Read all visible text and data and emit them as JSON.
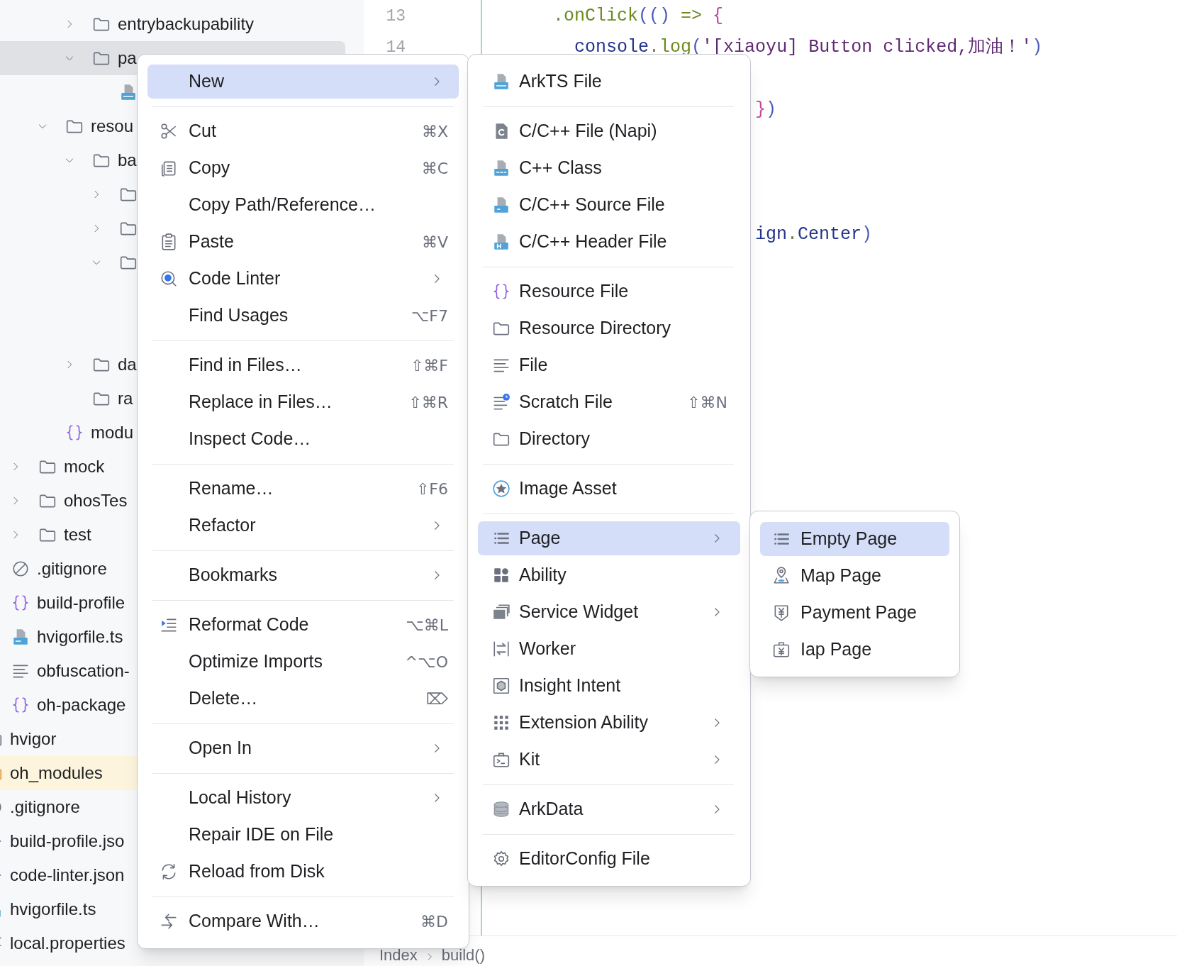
{
  "project_tree": {
    "items": [
      {
        "kind": "offscreen",
        "children": [
          {
            "kind": "offscreen",
            "children": [
              {
                "kind": "offscreen",
                "children": [
                  {
                    "kind": "offscreen",
                    "children": [
                      {
                        "kind": "folder",
                        "label": "entrybackupability",
                        "expanded": false,
                        "selected": false
                      },
                      {
                        "kind": "folder",
                        "label": "pa",
                        "expanded": true,
                        "selected": true,
                        "children": [
                          {
                            "kind": "ets-file",
                            "selected": false
                          }
                        ]
                      }
                    ]
                  },
                  {
                    "kind": "folder",
                    "label": "resou",
                    "expanded": true,
                    "selected": false,
                    "children": [
                      {
                        "kind": "folder",
                        "label": "ba",
                        "expanded": true,
                        "selected": false,
                        "children": [
                          {
                            "kind": "folder",
                            "expanded": false,
                            "selected": false
                          },
                          {
                            "kind": "folder",
                            "expanded": false,
                            "selected": false
                          },
                          {
                            "kind": "folder",
                            "expanded": true,
                            "selected": false,
                            "children": [
                              {
                                "kind": "covered"
                              },
                              {
                                "kind": "covered"
                              }
                            ]
                          }
                        ]
                      },
                      {
                        "kind": "folder",
                        "label": "da",
                        "expanded": false,
                        "selected": false
                      },
                      {
                        "kind": "folder",
                        "label": "ra",
                        "selected": false
                      }
                    ]
                  },
                  {
                    "kind": "json-file",
                    "label": "modu",
                    "selected": false
                  }
                ]
              },
              {
                "kind": "folder",
                "label": "mock",
                "expanded": false,
                "selected": false
              },
              {
                "kind": "folder",
                "label": "ohosTes",
                "expanded": false,
                "selected": false
              },
              {
                "kind": "folder",
                "label": "test",
                "expanded": false,
                "selected": false
              }
            ]
          },
          {
            "kind": "ignore-file",
            "label": ".gitignore",
            "selected": false
          },
          {
            "kind": "json-file",
            "label": "build-profile",
            "selected": false
          },
          {
            "kind": "ts-file",
            "label": "hvigorfile.ts",
            "selected": false
          },
          {
            "kind": "text-file",
            "label": "obfuscation-",
            "selected": false
          },
          {
            "kind": "json-file",
            "label": "oh-package",
            "selected": false
          }
        ]
      },
      {
        "kind": "folder",
        "label": "hvigor",
        "selected": false
      },
      {
        "kind": "library-folder",
        "label": "oh_modules",
        "selected": false
      },
      {
        "kind": "ignore-file",
        "label": ".gitignore",
        "selected": false
      },
      {
        "kind": "json-file",
        "label": "build-profile.jso",
        "selected": false
      },
      {
        "kind": "json-file",
        "label": "code-linter.json",
        "selected": false
      },
      {
        "kind": "ts-file",
        "label": "hvigorfile.ts",
        "selected": false
      },
      {
        "kind": "text-file",
        "label": "local.properties",
        "selected": false
      }
    ]
  },
  "editor": {
    "lines": [
      {
        "kind": "code",
        "number": "13",
        "tokens": [
          {
            "text": "      .",
            "kind": "dot"
          },
          {
            "text": "onClick",
            "kind": "method"
          },
          {
            "text": "(() ",
            "kind": "paren"
          },
          {
            "text": "=>",
            "kind": "operator"
          },
          {
            "text": " {",
            "kind": "brace"
          }
        ]
      },
      {
        "kind": "code",
        "number": "14",
        "tokens": [
          {
            "text": "        console",
            "kind": "ident"
          },
          {
            "text": ".",
            "kind": "dot"
          },
          {
            "text": "log",
            "kind": "method"
          },
          {
            "text": "(",
            "kind": "paren"
          },
          {
            "text": "'[xiaoyu] Button clicked,加油！'",
            "kind": "string"
          },
          {
            "text": ")",
            "kind": "paren"
          }
        ]
      },
      {
        "kind": "covered"
      },
      {
        "kind": "code",
        "tokens": [
          {
            "text": "                         }",
            "kind": "brace"
          },
          {
            "text": ")",
            "kind": "paren"
          }
        ]
      },
      {
        "kind": "covered"
      },
      {
        "kind": "covered"
      },
      {
        "kind": "covered"
      },
      {
        "kind": "code",
        "tokens": [
          {
            "text": "                         ign",
            "kind": "ident"
          },
          {
            "text": ".",
            "kind": "dot"
          },
          {
            "text": "Center",
            "kind": "ident"
          },
          {
            "text": ")",
            "kind": "paren"
          }
        ]
      }
    ],
    "breadcrumb": [
      "Index",
      "build()"
    ]
  },
  "context_menu": {
    "items": [
      {
        "label": "New",
        "submenu": true,
        "selected": true
      },
      {
        "kind": "separator"
      },
      {
        "label": "Cut",
        "shortcut": "⌘X",
        "submenu": false,
        "selected": false
      },
      {
        "label": "Copy",
        "shortcut": "⌘C",
        "submenu": false,
        "selected": false
      },
      {
        "label": "Copy Path/Reference…",
        "submenu": false,
        "selected": false
      },
      {
        "label": "Paste",
        "shortcut": "⌘V",
        "submenu": false,
        "selected": false
      },
      {
        "label": "Code Linter",
        "submenu": true,
        "selected": false
      },
      {
        "label": "Find Usages",
        "shortcut": "⌥F7",
        "submenu": false,
        "selected": false
      },
      {
        "kind": "separator"
      },
      {
        "label": "Find in Files…",
        "shortcut": "⇧⌘F",
        "submenu": false,
        "selected": false
      },
      {
        "label": "Replace in Files…",
        "shortcut": "⇧⌘R",
        "submenu": false,
        "selected": false
      },
      {
        "label": "Inspect Code…",
        "submenu": false,
        "selected": false
      },
      {
        "kind": "separator"
      },
      {
        "label": "Rename…",
        "shortcut": "⇧F6",
        "submenu": false,
        "selected": false
      },
      {
        "label": "Refactor",
        "submenu": true,
        "selected": false
      },
      {
        "kind": "separator"
      },
      {
        "label": "Bookmarks",
        "submenu": true,
        "selected": false
      },
      {
        "kind": "separator"
      },
      {
        "label": "Reformat Code",
        "shortcut": "⌥⌘L",
        "submenu": false,
        "selected": false
      },
      {
        "label": "Optimize Imports",
        "shortcut": "^⌥O",
        "submenu": false,
        "selected": false
      },
      {
        "label": "Delete…",
        "shortcut": "⌦",
        "submenu": false,
        "selected": false
      },
      {
        "kind": "separator"
      },
      {
        "label": "Open In",
        "submenu": true,
        "selected": false
      },
      {
        "kind": "separator"
      },
      {
        "label": "Local History",
        "submenu": true,
        "selected": false
      },
      {
        "label": "Repair IDE on File",
        "submenu": false,
        "selected": false
      },
      {
        "label": "Reload from Disk",
        "submenu": false,
        "selected": false
      },
      {
        "kind": "separator"
      },
      {
        "label": "Compare With…",
        "shortcut": "⌘D",
        "submenu": false,
        "selected": false
      }
    ]
  },
  "new_submenu": {
    "items": [
      {
        "label": "ArkTS File",
        "submenu": false,
        "selected": false
      },
      {
        "kind": "separator"
      },
      {
        "label": "C/C++ File (Napi)",
        "submenu": false,
        "selected": false
      },
      {
        "label": "C++ Class",
        "submenu": false,
        "selected": false
      },
      {
        "label": "C/C++ Source File",
        "submenu": false,
        "selected": false
      },
      {
        "label": "C/C++ Header File",
        "submenu": false,
        "selected": false
      },
      {
        "kind": "separator"
      },
      {
        "label": "Resource File",
        "submenu": false,
        "selected": false
      },
      {
        "label": "Resource Directory",
        "submenu": false,
        "selected": false
      },
      {
        "label": "File",
        "submenu": false,
        "selected": false
      },
      {
        "label": "Scratch File",
        "shortcut": "⇧⌘N",
        "submenu": false,
        "selected": false
      },
      {
        "label": "Directory",
        "submenu": false,
        "selected": false
      },
      {
        "kind": "separator"
      },
      {
        "label": "Image Asset",
        "submenu": false,
        "selected": false
      },
      {
        "kind": "separator"
      },
      {
        "label": "Page",
        "submenu": true,
        "selected": true
      },
      {
        "label": "Ability",
        "submenu": false,
        "selected": false
      },
      {
        "label": "Service Widget",
        "submenu": true,
        "selected": false
      },
      {
        "label": "Worker",
        "submenu": false,
        "selected": false
      },
      {
        "label": "Insight Intent",
        "submenu": false,
        "selected": false
      },
      {
        "label": "Extension Ability",
        "submenu": true,
        "selected": false
      },
      {
        "label": "Kit",
        "submenu": true,
        "selected": false
      },
      {
        "kind": "separator"
      },
      {
        "label": "ArkData",
        "submenu": true,
        "selected": false
      },
      {
        "kind": "separator"
      },
      {
        "label": "EditorConfig File",
        "submenu": false,
        "selected": false
      }
    ]
  },
  "page_submenu": {
    "items": [
      {
        "label": "Empty Page",
        "submenu": false,
        "selected": true
      },
      {
        "label": "Map Page",
        "submenu": false,
        "selected": false
      },
      {
        "label": "Payment Page",
        "submenu": false,
        "selected": false
      },
      {
        "label": "Iap Page",
        "submenu": false,
        "selected": false
      }
    ]
  }
}
